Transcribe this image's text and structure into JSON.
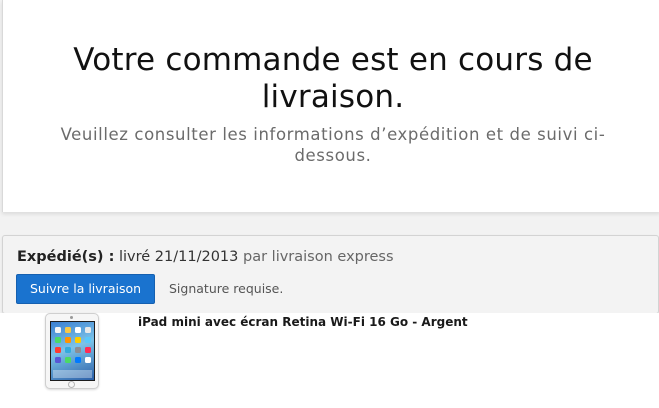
{
  "hero": {
    "title": "Votre commande est en cours de livraison.",
    "subtitle": "Veuillez consulter les informations d’expédition et de suivi ci-dessous."
  },
  "shipment": {
    "status_label": "Expédié(s) :",
    "status_date": "livré 21/11/2013",
    "status_carrier": "par livraison express",
    "track_button": "Suivre la livraison",
    "signature_note": "Signature requise."
  },
  "product": {
    "name": "iPad mini avec écran Retina Wi-Fi 16 Go - Argent",
    "icon": "ipad-mini-thumbnail"
  },
  "colors": {
    "accent": "#1a73cf",
    "panel_background": "#f3f3f3"
  }
}
